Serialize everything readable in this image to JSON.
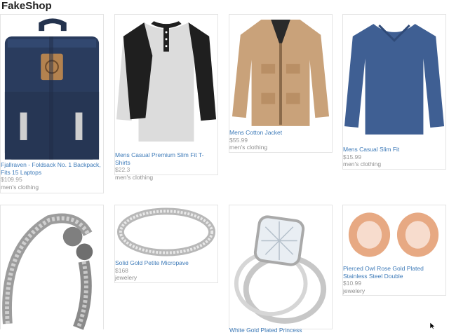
{
  "app": {
    "brand": "FakeShop"
  },
  "products": [
    {
      "title": "Fjallraven - Foldsack No. 1 Backpack, Fits 15 Laptops",
      "price": "$109.95",
      "category": "men's clothing",
      "image_icon": "backpack-image"
    },
    {
      "title": "Mens Casual Premium Slim Fit T-Shirts",
      "price": "$22.3",
      "category": "men's clothing",
      "image_icon": "tshirt-image"
    },
    {
      "title": "Mens Cotton Jacket",
      "price": "$55.99",
      "category": "men's clothing",
      "image_icon": "jacket-image"
    },
    {
      "title": "Mens Casual Slim Fit",
      "price": "$15.99",
      "category": "men's clothing",
      "image_icon": "longsleeve-image"
    },
    {
      "title": "",
      "price": "",
      "category": "",
      "image_icon": "bracelet-image"
    },
    {
      "title": "Solid Gold Petite Micropave",
      "price": "$168",
      "category": "jewelery",
      "image_icon": "ring-image"
    },
    {
      "title": "White Gold Plated Princess",
      "price": "",
      "category": "",
      "image_icon": "diamond-ring-image"
    },
    {
      "title": "Pierced Owl Rose Gold Plated Stainless Steel Double",
      "price": "$10.99",
      "category": "jewelery",
      "image_icon": "earrings-image"
    }
  ],
  "colors": {
    "link": "#3d7ab8",
    "muted": "#9a9a9a",
    "border": "#e4e4e4"
  }
}
